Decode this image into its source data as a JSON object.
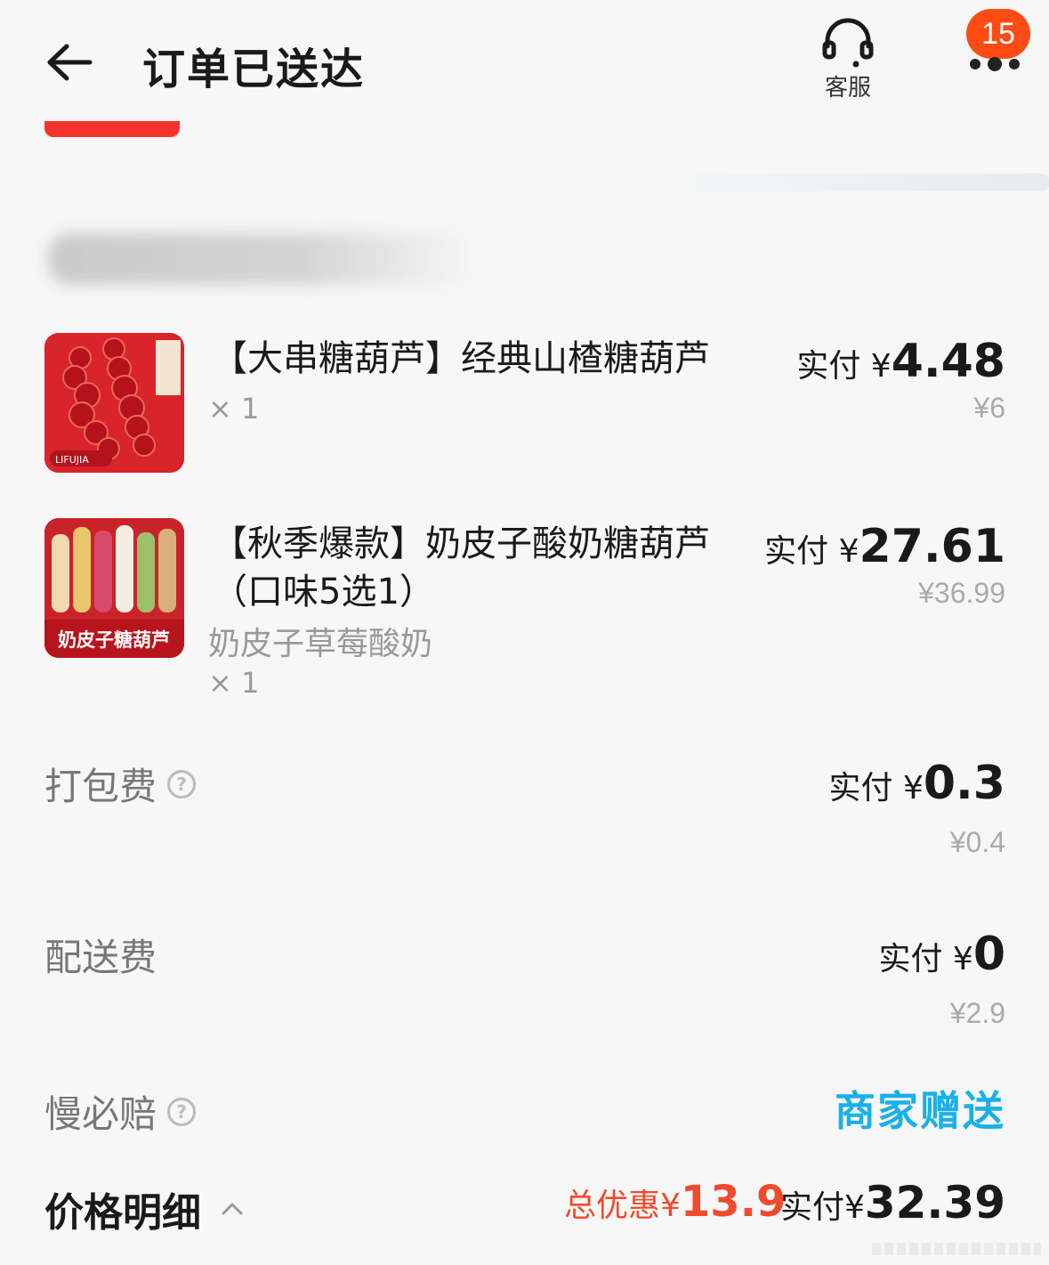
{
  "header": {
    "title": "订单已送达",
    "customer_service_label": "客服",
    "notification_count": "15"
  },
  "items": [
    {
      "name": "【大串糖葫芦】经典山楂糖葫芦",
      "spec": "",
      "qty": "× 1",
      "pay_label": "实付 ¥",
      "pay_value": "4.48",
      "original_price": "¥6"
    },
    {
      "name": "【秋季爆款】奶皮子酸奶糖葫芦（口味5选1）",
      "spec": "奶皮子草莓酸奶",
      "qty": "× 1",
      "pay_label": "实付 ¥",
      "pay_value": "27.61",
      "original_price": "¥36.99",
      "thumb_text": "奶皮子糖葫芦"
    }
  ],
  "fees": {
    "packing": {
      "label": "打包费",
      "pay_label": "实付 ¥",
      "pay_value": "0.3",
      "original_price": "¥0.4"
    },
    "delivery": {
      "label": "配送费",
      "pay_label": "实付 ¥",
      "pay_value": "0",
      "original_price": "¥2.9"
    },
    "slow_compensation": {
      "label": "慢必赔",
      "value": "商家赠送"
    }
  },
  "summary": {
    "label": "价格明细",
    "discount_label": "总优惠¥",
    "discount_value": "13.9",
    "total_label": "实付¥",
    "total_value": "32.39"
  },
  "thumb1_brand": "LIFUJIA",
  "colors": {
    "accent_red": "#f5332d",
    "badge_orange": "#ff4b14",
    "gift_blue": "#1ab0e8",
    "discount_red": "#f04b2d"
  }
}
